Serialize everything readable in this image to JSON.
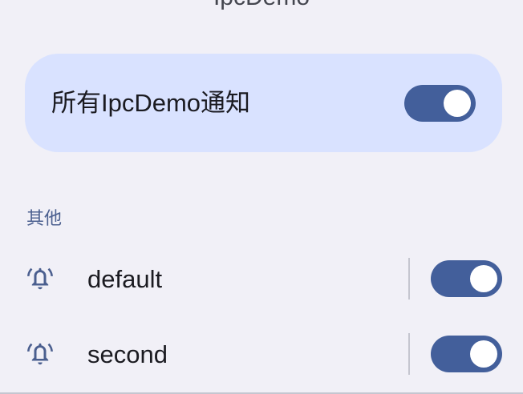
{
  "header": {
    "app_title": "IpcDemo"
  },
  "master": {
    "label": "所有IpcDemo通知",
    "enabled": true
  },
  "section": {
    "title": "其他"
  },
  "channels": [
    {
      "label": "default",
      "icon": "bell-ringing-icon",
      "enabled": true
    },
    {
      "label": "second",
      "icon": "bell-ringing-icon",
      "enabled": true
    }
  ],
  "colors": {
    "background": "#f1f0f7",
    "card": "#d9e2ff",
    "switch_track": "#435f9b",
    "switch_thumb": "#ffffff",
    "section_header": "#4b5f8f"
  }
}
